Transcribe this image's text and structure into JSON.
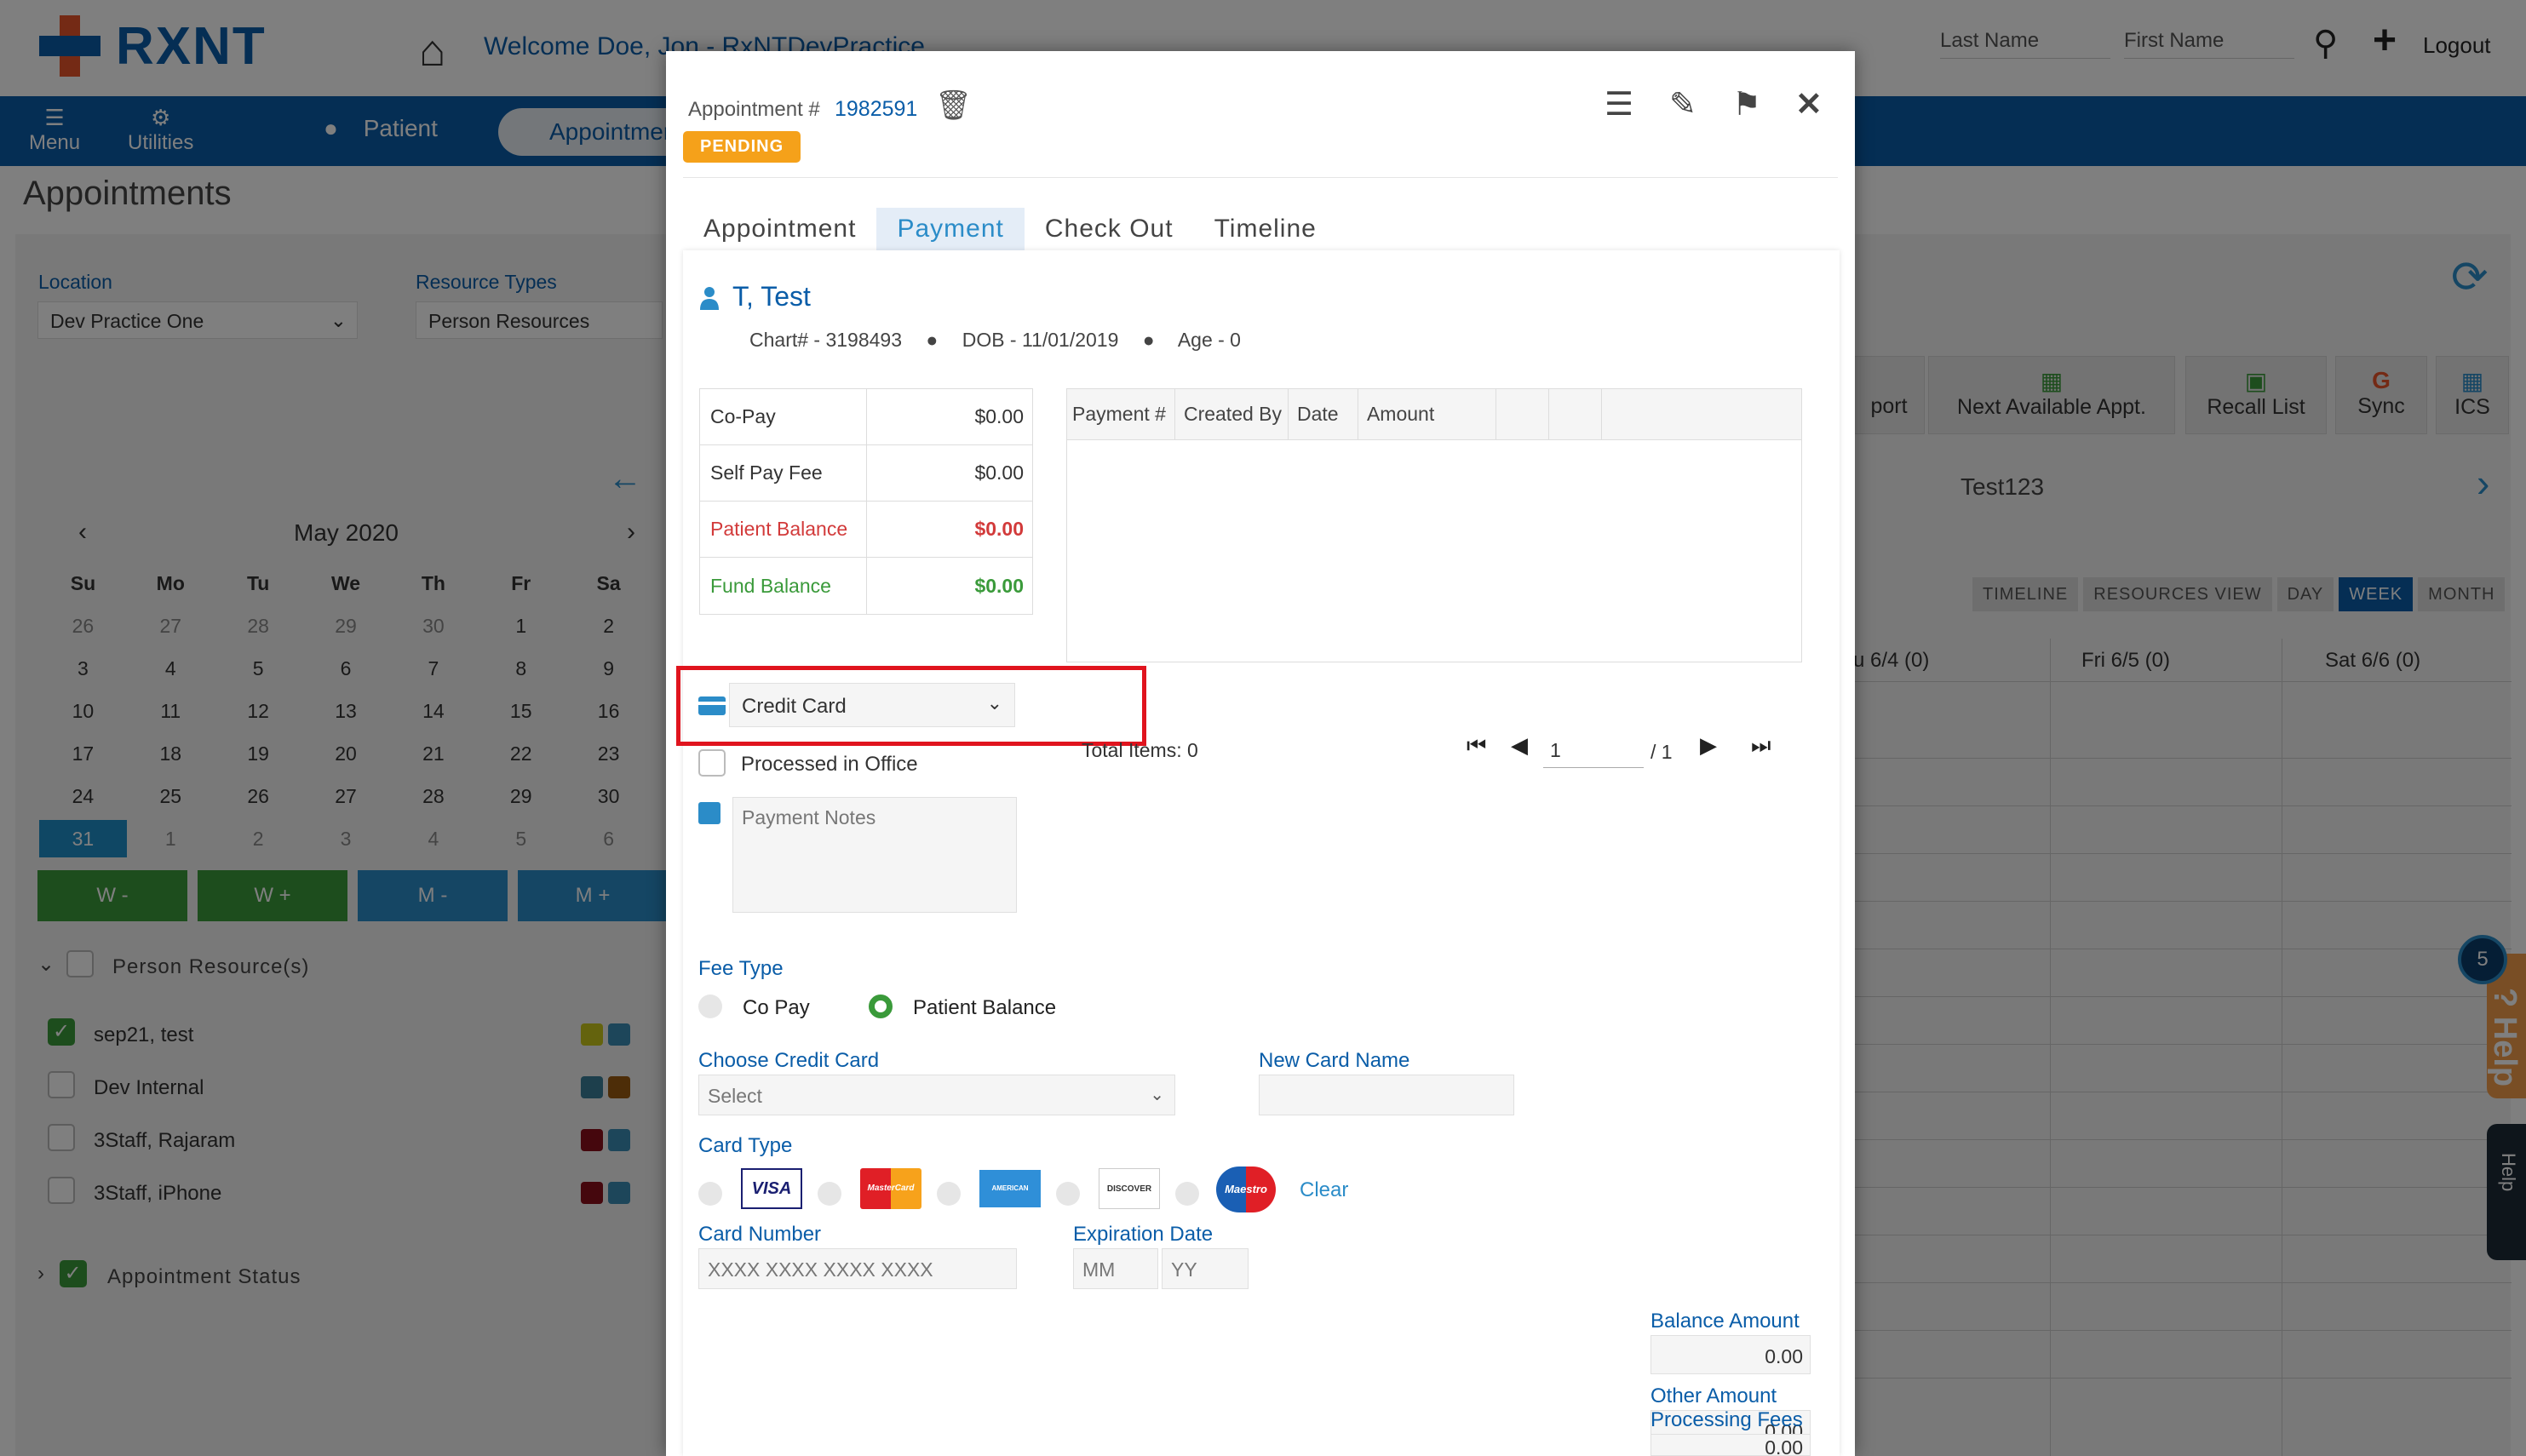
{
  "header": {
    "brand": "RXNT",
    "welcome": "Welcome  Doe, Jon - RxNTDevPractice",
    "last_name_placeholder": "Last Name",
    "first_name_placeholder": "First Name",
    "logout": "Logout"
  },
  "nav": {
    "menu": "Menu",
    "utilities": "Utilities",
    "patient": "Patient",
    "appointments": "Appointments"
  },
  "page": {
    "title": "Appointments",
    "location_label": "Location",
    "location_value": "Dev Practice One",
    "resource_types_label": "Resource Types",
    "resource_types_value": "Person Resources"
  },
  "calendar": {
    "month": "May 2020",
    "weekdays": [
      "Su",
      "Mo",
      "Tu",
      "We",
      "Th",
      "Fr",
      "Sa"
    ],
    "weeks": [
      [
        "26",
        "27",
        "28",
        "29",
        "30",
        "1",
        "2"
      ],
      [
        "3",
        "4",
        "5",
        "6",
        "7",
        "8",
        "9"
      ],
      [
        "10",
        "11",
        "12",
        "13",
        "14",
        "15",
        "16"
      ],
      [
        "17",
        "18",
        "19",
        "20",
        "21",
        "22",
        "23"
      ],
      [
        "24",
        "25",
        "26",
        "27",
        "28",
        "29",
        "30"
      ],
      [
        "31",
        "1",
        "2",
        "3",
        "4",
        "5",
        "6"
      ]
    ],
    "buttons": [
      "W -",
      "W +",
      "M -",
      "M +"
    ]
  },
  "resources": {
    "header": "Person Resource(s)",
    "items": [
      "sep21, test",
      "Dev Internal",
      "3Staff, Rajaram",
      "3Staff, iPhone"
    ],
    "status_header": "Appointment Status"
  },
  "right": {
    "toolbar": [
      "port",
      "Next Available Appt.",
      "Recall List",
      "Sync",
      "ICS"
    ],
    "resource_title": "Test123",
    "view_tabs": [
      "TIMELINE",
      "RESOURCES VIEW",
      "DAY",
      "WEEK",
      "MONTH"
    ],
    "days": [
      "u 6/4 (0)",
      "Fri 6/5 (0)",
      "Sat 6/6 (0)"
    ],
    "help_badge": "5",
    "help_label": "? Help",
    "help_small": "Help"
  },
  "modal": {
    "appt_label": "Appointment #",
    "appt_number": "1982591",
    "status": "PENDING",
    "tabs": [
      "Appointment",
      "Payment",
      "Check Out",
      "Timeline"
    ],
    "patient": {
      "name": "T, Test",
      "chart": "Chart# - 3198493",
      "dob": "DOB - 11/01/2019",
      "age": "Age - 0"
    },
    "financials": [
      {
        "label": "Co-Pay",
        "value": "$0.00"
      },
      {
        "label": "Self Pay Fee",
        "value": "$0.00"
      },
      {
        "label": "Patient Balance",
        "value": "$0.00"
      },
      {
        "label": "Fund Balance",
        "value": "$0.00"
      }
    ],
    "payments_table": {
      "columns": [
        "Payment #",
        "Created By",
        "Date",
        "Amount"
      ],
      "total_items": "Total Items: 0",
      "page": "1",
      "of": "/ 1"
    },
    "payment_method": "Credit Card",
    "processed_in_office": "Processed in Office",
    "notes_placeholder": "Payment Notes",
    "fee_type": {
      "label": "Fee Type",
      "options": [
        "Co Pay",
        "Patient Balance"
      ],
      "selected": "Patient Balance"
    },
    "choose_card": {
      "label": "Choose Credit Card",
      "value": "Select"
    },
    "new_card_name": {
      "label": "New Card Name",
      "value": ""
    },
    "card_type": {
      "label": "Card Type",
      "logos": [
        "VISA",
        "MasterCard",
        "AMERICAN EXPRESS",
        "DISCOVER",
        "Maestro"
      ],
      "clear": "Clear"
    },
    "card_number": {
      "label": "Card Number",
      "placeholder": "XXXX XXXX XXXX XXXX"
    },
    "expiration": {
      "label": "Expiration Date",
      "mm": "MM",
      "yy": "YY"
    },
    "balance_amount": {
      "label": "Balance Amount",
      "value": "0.00"
    },
    "other_amount": {
      "label": "Other Amount",
      "value": "0.00"
    },
    "processing_fees": {
      "label": "Processing Fees",
      "value": "0.00"
    }
  },
  "colors": {
    "brand_blue": "#0a5da8",
    "accent_orange": "#e8542a",
    "pending": "#f5a11a",
    "highlight": "#e0141e",
    "green": "#3a9a3a",
    "red": "#d23a3a"
  }
}
